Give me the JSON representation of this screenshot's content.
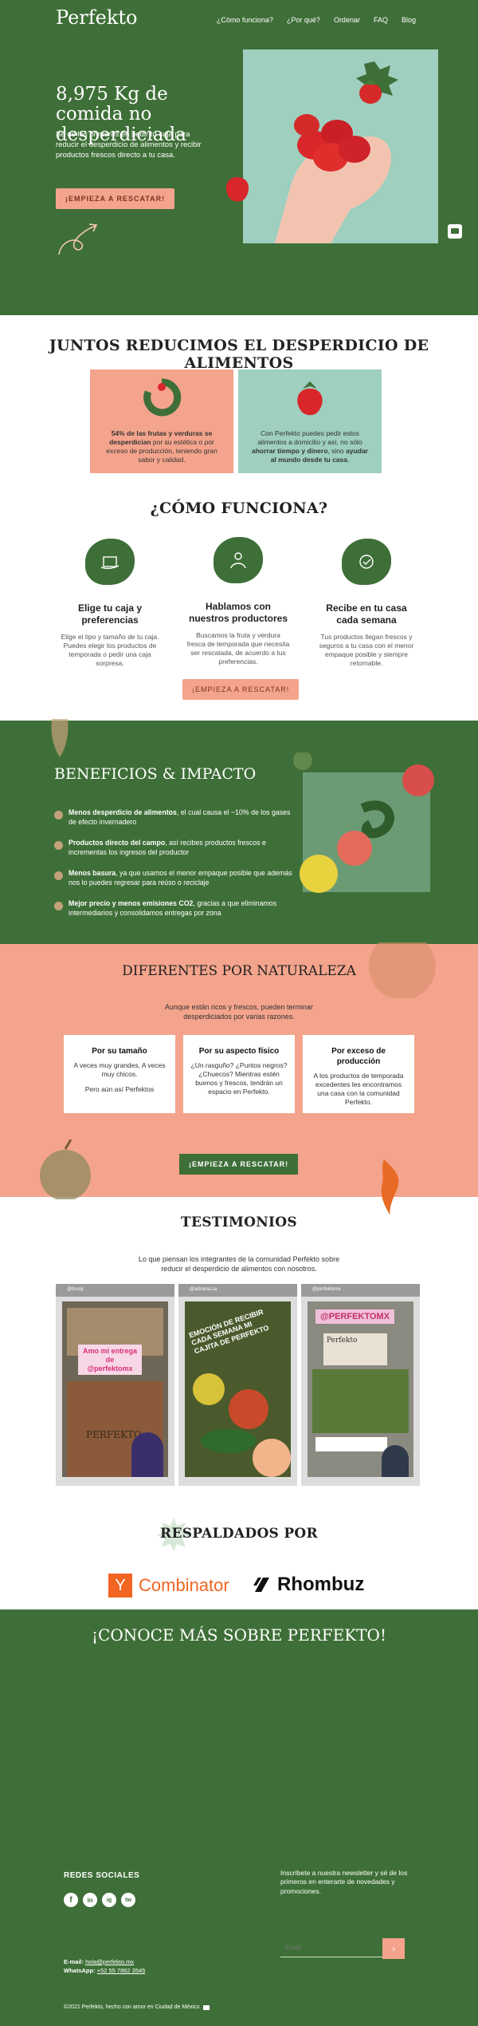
{
  "brand": "Perfekto",
  "nav": [
    "¿Cómo funciona?",
    "¿Por qué?",
    "Ordenar",
    "FAQ",
    "Blog"
  ],
  "hero": {
    "title": "8,975 Kg de comida no desperdiciada",
    "lead": "Sé de los primeros en pedir tu caja para reducir el desperdicio de alimentos y recibir productos frescos directo a tu casa.",
    "cta": "¡EMPIEZA A RESCATAR!"
  },
  "reduce": {
    "title": "JUNTOS REDUCIMOS EL DESPERDICIO DE ALIMENTOS",
    "card1": {
      "bold1": "54% de las frutas y verduras se desperdician",
      "rest": " por su estética o por exceso de producción, teniendo gran sabor y calidad."
    },
    "card2": {
      "text1": "Con Perfekto puedes pedir estos alimentos a domicilio y así, no sólo ",
      "bold1": "ahorrar tiempo y dinero",
      "text2": ", sino ",
      "bold2": "ayudar al mundo desde tu casa",
      "text3": "."
    }
  },
  "how": {
    "title": "¿CÓMO FUNCIONA?",
    "steps": [
      {
        "title": "Elige tu caja y preferencias",
        "text": "Elige el tipo y tamaño de tu caja. Puedes elegir los productos de temporada o pedir una caja sorpresa."
      },
      {
        "title": "Hablamos con nuestros productores",
        "text": "Buscamos la fruta y verdura fresca de temporada que necesita ser rescatada, de acuerdo a tus preferencias."
      },
      {
        "title": "Recibe en tu casa cada semana",
        "text": "Tus productos llegan frescos y seguros a tu casa con el menor empaque posible y siempre retornable."
      }
    ],
    "cta": "¡EMPIEZA A RESCATAR!"
  },
  "benefits": {
    "title": "BENEFICIOS & IMPACTO",
    "items": [
      {
        "bold": "Menos desperdicio de alimentos",
        "text": ", el cual causa el ~10% de los gases de efecto invernadero"
      },
      {
        "bold": "Productos directo del campo",
        "text": ", así recibes productos frescos e incrementas los ingresos del productor"
      },
      {
        "bold": "Menos basura",
        "text": ", ya que usamos el menor empaque posible que además nos lo puedes regresar para reúso o reciclaje"
      },
      {
        "bold": "Mejor precio y menos emisiones CO2",
        "text": ", gracias a que eliminamos intermediarios y consolidamos entregas por zona"
      }
    ]
  },
  "diff": {
    "title": "DIFERENTES POR NATURALEZA",
    "subtitle": "Aunque están ricos y frescos, pueden terminar desperdiciados por varias razones.",
    "cards": [
      {
        "title": "Por su tamaño",
        "text": "A veces muy grandes, A veces muy chicos.",
        "text2": "Pero aún así Perfektos"
      },
      {
        "title": "Por su aspecto físico",
        "text": "¿Un rasguño? ¿Puntos negros? ¿Chuecos? Mientras estén buenos y frescos, tendrán un espacio en Perfekto.",
        "text2": ""
      },
      {
        "title": "Por exceso de producción",
        "text": "A los productos de temporada excedentes les encontramos una casa con la comunidad Perfekto.",
        "text2": ""
      }
    ],
    "cta": "¡EMPIEZA A RESCATAR!"
  },
  "testimonials": {
    "title": "TESTIMONIOS",
    "subtitle": "Lo que piensan los integrantes de la comunidad Perfekto sobre reducir el desperdicio de alimentos con nosotros.",
    "cards": [
      {
        "handle": "@brunji",
        "caption": "Amo mi entrega de @perfektomx",
        "box_text": "PERFEKTO"
      },
      {
        "handle": "@adriana.ca",
        "caption": "EMOCIÓN DE RECIBIR CADA SEMANA MI CAJITA DE PERFEKTO",
        "box_text": ""
      },
      {
        "handle": "@perfektomx",
        "caption": "@PERFEKTOMX",
        "box_text": "Perfekto"
      }
    ]
  },
  "backers": {
    "title": "RESPALDADOS POR",
    "yc": "Combinator",
    "yc_mark": "Y",
    "rhombuz": "Rhombuz"
  },
  "more": {
    "title": "¡CONOCE MÁS SOBRE PERFEKTO!"
  },
  "footer": {
    "social_title": "REDES SOCIALES",
    "social": [
      "f",
      "in",
      "ig",
      "tw"
    ],
    "newsletter": "Inscríbete a nuestra newsletter y sé de los primeros en enterarte de novedades y promociones.",
    "email_placeholder": "Email",
    "email_label": "E-mail:",
    "email": "hola@perfekto.mx",
    "whatsapp_label": "WhatsApp:",
    "whatsapp": "+52 55 7862 3545",
    "copyright": "©2021 Perfekto, hecho con amor en Ciudad de México"
  },
  "colors": {
    "green": "#3f6f38",
    "salmon": "#f4a48c",
    "mint": "#9ecfbf"
  }
}
